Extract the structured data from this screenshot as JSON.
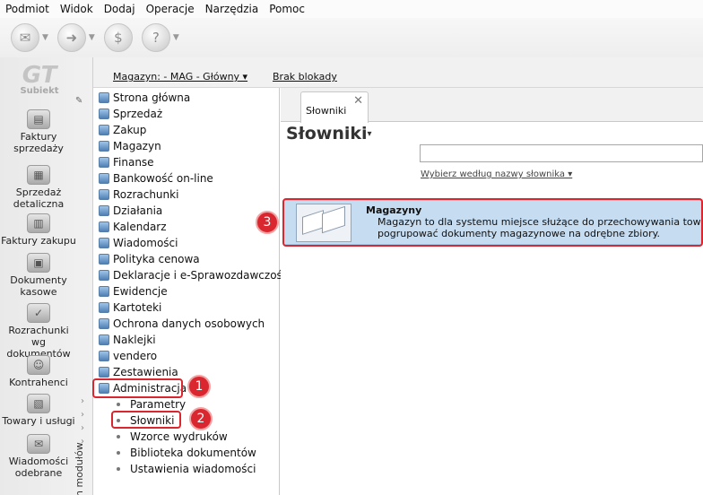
{
  "menu": [
    "Podmiot",
    "Widok",
    "Dodaj",
    "Operacje",
    "Narzędzia",
    "Pomoc"
  ],
  "toolbar": [
    {
      "icon": "envelope-icon",
      "glyph": "✉"
    },
    {
      "icon": "forward-icon",
      "glyph": "➜"
    },
    {
      "icon": "dollar-icon",
      "glyph": "$"
    },
    {
      "icon": "help-icon",
      "glyph": "?"
    }
  ],
  "logo": {
    "mark": "GT",
    "text": "Subiekt"
  },
  "modules": [
    {
      "label": "Faktury\nsprzedaży",
      "icon": "invoice-icon"
    },
    {
      "label": "Sprzedaż\ndetaliczna",
      "icon": "cash-register-icon"
    },
    {
      "label": "Faktury zakupu",
      "icon": "purchase-icon"
    },
    {
      "label": "Dokumenty\nkasowe",
      "icon": "cash-docs-icon"
    },
    {
      "label": "Rozrachunki wg\ndokumentów",
      "icon": "settlement-icon"
    },
    {
      "label": "Kontrahenci",
      "icon": "contractor-icon"
    },
    {
      "label": "Towary i usługi",
      "icon": "goods-icon"
    },
    {
      "label": "Wiadomości\nodebrane",
      "icon": "messages-icon"
    }
  ],
  "modules_vertical_label": "n modułów",
  "infobar": {
    "warehouse": "Magazyn: - MAG - Główny ▾",
    "lock": "Brak blokady"
  },
  "tree": [
    "Strona główna",
    "Sprzedaż",
    "Zakup",
    "Magazyn",
    "Finanse",
    "Bankowość on-line",
    "Rozrachunki",
    "Działania",
    "Kalendarz",
    "Wiadomości",
    "Polityka cenowa",
    "Deklaracje i e-Sprawozdawczość",
    "Ewidencje",
    "Kartoteki",
    "Ochrona danych osobowych",
    "Naklejki",
    "vendero",
    "Zestawienia",
    "Administracja"
  ],
  "submenu": [
    "Parametry",
    "Słowniki",
    "Wzorce wydruków",
    "Biblioteka dokumentów",
    "Ustawienia wiadomości"
  ],
  "badges": [
    "1",
    "2",
    "3"
  ],
  "tab": {
    "label": "Słowniki",
    "close": "✕"
  },
  "page": {
    "title": "Słowniki",
    "title_arrow": "▾",
    "search_value": "",
    "hint": "Wybierz według nazwy słownika ▾"
  },
  "item": {
    "name": "Magazyny",
    "desc_line1": "Magazyn to dla systemu miejsce służące do przechowywania towarów.",
    "desc_line2": "pogrupować dokumenty magazynowe na odrębne zbiory."
  },
  "colors": {
    "highlight": "#c6dcf1",
    "annotation": "#d9262f"
  }
}
